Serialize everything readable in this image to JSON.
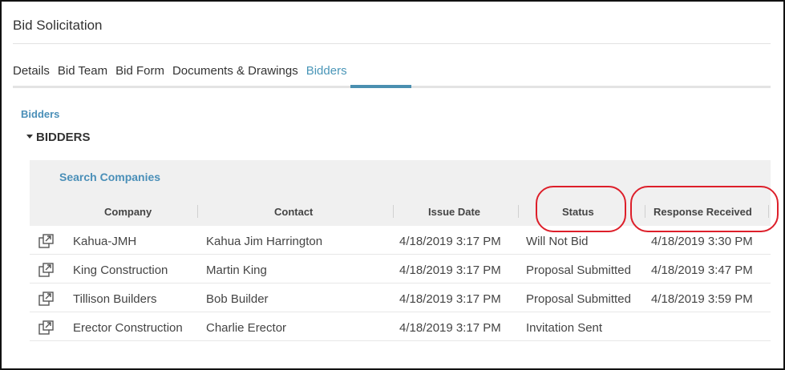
{
  "window": {
    "title": "Bid Solicitation"
  },
  "tabs": [
    {
      "label": "Details"
    },
    {
      "label": "Bid Team"
    },
    {
      "label": "Bid Form"
    },
    {
      "label": "Documents & Drawings"
    },
    {
      "label": "Bidders"
    }
  ],
  "active_tab": "Bidders",
  "breadcrumb": "Bidders",
  "section": {
    "title": "BIDDERS"
  },
  "grid": {
    "search_label": "Search Companies",
    "columns": [
      "Company",
      "Contact",
      "Issue Date",
      "Status",
      "Response Received"
    ],
    "rows": [
      {
        "company": "Kahua-JMH",
        "contact": "Kahua Jim Harrington",
        "issue_date": "4/18/2019 3:17 PM",
        "status": "Will Not Bid",
        "response": "4/18/2019 3:30 PM"
      },
      {
        "company": "King Construction",
        "contact": "Martin King",
        "issue_date": "4/18/2019 3:17 PM",
        "status": "Proposal Submitted",
        "response": "4/18/2019 3:47 PM"
      },
      {
        "company": "Tillison Builders",
        "contact": "Bob Builder",
        "issue_date": "4/18/2019 3:17 PM",
        "status": "Proposal Submitted",
        "response": "4/18/2019 3:59 PM"
      },
      {
        "company": "Erector Construction",
        "contact": "Charlie Erector",
        "issue_date": "4/18/2019 3:17 PM",
        "status": "Invitation Sent",
        "response": ""
      }
    ]
  },
  "colors": {
    "accent": "#4a8fb8",
    "annotation": "#dd1f2a"
  },
  "icons": {
    "row_open": "open-in-window-icon",
    "section_toggle": "caret-down-icon"
  }
}
